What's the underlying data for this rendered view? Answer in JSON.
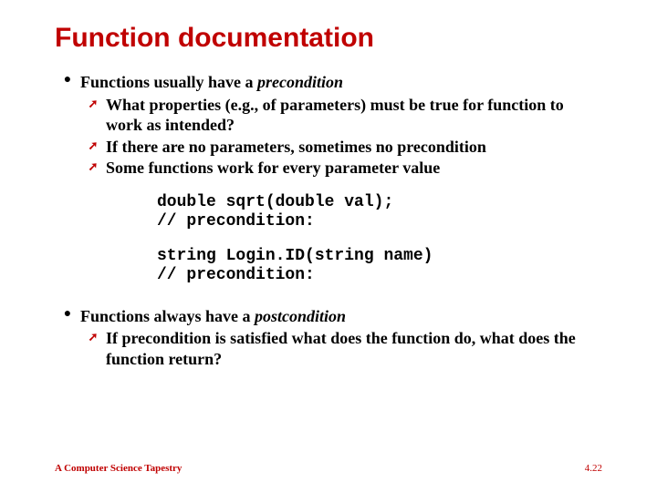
{
  "title": "Function documentation",
  "b1": {
    "lead": "Functions usually have a ",
    "em": "precondition",
    "subs": [
      "What properties (e.g., of parameters) must be true for function to work as intended?",
      "If there are no parameters, sometimes no precondition",
      "Some functions work for every parameter value"
    ]
  },
  "code1": "double sqrt(double val);\n// precondition:",
  "code2": "string Login.ID(string name)\n// precondition:",
  "b2": {
    "lead": "Functions always have a ",
    "em": "postcondition",
    "subs": [
      "If precondition is satisfied what does the function do, what does the function return?"
    ]
  },
  "footer": {
    "left": "A Computer Science Tapestry",
    "right": "4.22"
  },
  "glyph": {
    "dot": "●",
    "arrow": "➚"
  }
}
